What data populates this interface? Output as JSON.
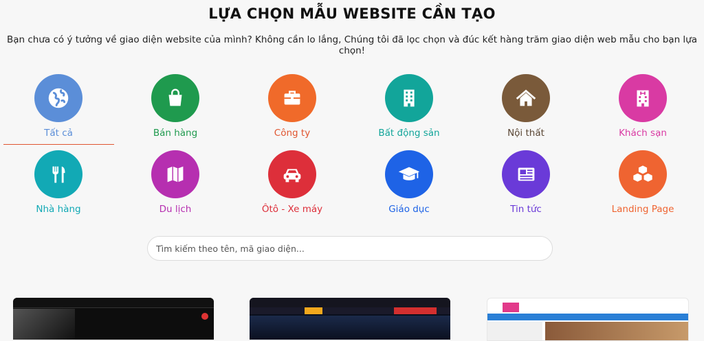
{
  "header": {
    "title": "LỰA CHỌN MẪU WEBSITE CẦN TẠO",
    "subtitle": "Bạn chưa có ý tưởng về giao diện website của mình? Không cần lo lắng, Chúng tôi đã lọc chọn và đúc kết hàng trăm giao diện web mẫu cho bạn lựa chọn!"
  },
  "categories": [
    {
      "label": "Tất cả",
      "icon": "globe-icon",
      "color": "#5b8ed8",
      "active": true
    },
    {
      "label": "Bán hàng",
      "icon": "shopping-bag-icon",
      "color": "#1f9a4e"
    },
    {
      "label": "Công ty",
      "icon": "briefcase-icon",
      "color": "#f06a2a"
    },
    {
      "label": "Bất động sản",
      "icon": "building-icon",
      "color": "#12a59a"
    },
    {
      "label": "Nội thất",
      "icon": "house-icon",
      "color": "#7a5a3a"
    },
    {
      "label": "Khách sạn",
      "icon": "hotel-icon",
      "color": "#d93aa3"
    },
    {
      "label": "Nhà hàng",
      "icon": "fork-knife-icon",
      "color": "#12a9b5"
    },
    {
      "label": "Du lịch",
      "icon": "map-icon",
      "color": "#b62fb0"
    },
    {
      "label": "Ôtô - Xe máy",
      "icon": "car-icon",
      "color": "#dd2f3a"
    },
    {
      "label": "Giáo dục",
      "icon": "graduation-cap-icon",
      "color": "#1e63e6"
    },
    {
      "label": "Tin tức",
      "icon": "newspaper-icon",
      "color": "#6a3ad8"
    },
    {
      "label": "Landing Page",
      "icon": "boxes-icon",
      "color": "#ef6431"
    }
  ],
  "search": {
    "placeholder": "Tìm kiếm theo tên, mã giao diện..."
  }
}
